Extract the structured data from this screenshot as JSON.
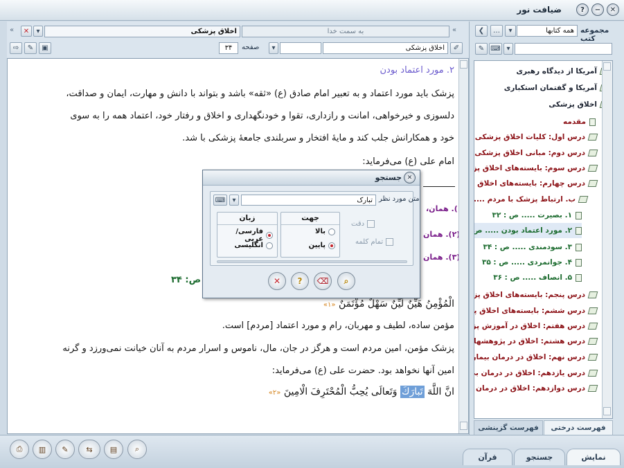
{
  "window": {
    "title": "ضیافت نور",
    "controls": [
      "close-icon",
      "minimize-icon",
      "help-icon"
    ]
  },
  "right_panel": {
    "label": "مجموعه کتب",
    "collection_select": "همه کتابها",
    "search_value": "",
    "tree": [
      {
        "label": "آمریکا از دیدگاه رهبری",
        "kind": "book",
        "color": "dark"
      },
      {
        "label": "آمریکا و گفتمان استکباری",
        "kind": "book",
        "color": "dark"
      },
      {
        "label": "اخلاق پزشکی",
        "kind": "book-open",
        "color": "dark"
      },
      {
        "label": "مقدمه",
        "kind": "page",
        "color": "red"
      },
      {
        "label": "درس اول: کلیات اخلاق پزشکی",
        "kind": "book",
        "color": "red"
      },
      {
        "label": "درس دوم: مبانی اخلاق پزشکی",
        "kind": "book",
        "color": "red"
      },
      {
        "label": "درس سوم: بایسته‌های اخلاق پز",
        "kind": "book",
        "color": "red"
      },
      {
        "label": "درس چهارم: بایسته‌های اخلاق پز",
        "kind": "book-open",
        "color": "red"
      },
      {
        "label": "ب. ارتباط پزشک با مردم ....",
        "kind": "book-open",
        "color": "red"
      },
      {
        "label": "۱. بصیرت ..... ص : ۳۲",
        "kind": "page",
        "color": "green"
      },
      {
        "label": "۲. مورد اعتماد بودن ..... ص",
        "kind": "page",
        "color": "green",
        "selected": true
      },
      {
        "label": "۳. سودمندی ..... ص : ۳۴",
        "kind": "page",
        "color": "green"
      },
      {
        "label": "۴. جوانمردی ..... ص : ۳۵",
        "kind": "page",
        "color": "green"
      },
      {
        "label": "۵. انصاف ..... ص : ۳۶",
        "kind": "page",
        "color": "green"
      },
      {
        "label": "درس پنجم: بایسته‌های اخلاق پز",
        "kind": "book",
        "color": "red"
      },
      {
        "label": "درس ششم: بایسته‌های اخلاق پز",
        "kind": "book",
        "color": "red"
      },
      {
        "label": "درس هفتم: اخلاق در آموزش پز",
        "kind": "book",
        "color": "red"
      },
      {
        "label": "درس هشتم: اخلاق در پژوهشهای",
        "kind": "book",
        "color": "red"
      },
      {
        "label": "درس نهم: اخلاق در درمان بیمار",
        "kind": "book",
        "color": "red"
      },
      {
        "label": "درس یازدهم: اخلاق در درمان بی",
        "kind": "book",
        "color": "red"
      },
      {
        "label": "درس دوازدهم: اخلاق در درمان بی",
        "kind": "book",
        "color": "red"
      }
    ],
    "tabs": {
      "tree": "فهرست درختی",
      "selective": "فهرست گزینشی"
    }
  },
  "main": {
    "book_title": "اخلاق پزشکی",
    "direction_hint": "به سمت خدا",
    "book_field": "اخلاق پزشکی",
    "page_label": "صفحه",
    "page_value": "۳۴",
    "heading": "۲. مورد اعتماد بودن",
    "paragraph": [
      "پزشک باید مورد اعتماد و به تعبیر امام صادق (ع) «ثقه» باشد و بتواند با دانش و مهارت، ایمان و صداقت،",
      "دلسوزی و خیرخواهی، امانت و رازداری، تقوا و خودنگهداری و اخلاق و رفتار خود، اعتماد همه را به سوی",
      "خود و همکارانش جلب کند و مایهٔ افتخار و سربلندی جامعهٔ پزشکی با شد."
    ],
    "imam_line": "امام علی (ع) می‌فرماید:",
    "footnotes": [
      "(۱). همان،",
      "(۲). همان",
      "(۳). همان"
    ],
    "page_marker": "ص: ۳۴",
    "arabic1": "الْمُؤْمِنُ هَيِّنٌ لَيِّنٌ سَهْلٌ مُؤْتَمَنٌ",
    "ref1": "«۱»",
    "line2": "مؤمن ساده، لطیف و مهربان، رام و مورد اعتماد [مردم] است.",
    "line3": "پزشک مؤمن، امین مردم است و هرگز در جان، مال، ناموس و اسرار مردم به آنان خیانت نمی‌ورزد و گرنه",
    "line4": "امین آنها نخواهد بود. حضرت علی (ع) می‌فرماید:",
    "arabic2_a": "انَّ اللَّهَ",
    "arabic2_highlight": "تَبارَكَ",
    "arabic2_b": "وَتَعالَى يُحِبُّ الْمُحْتَرِفَ الْامِينَ",
    "ref2": "«۲»"
  },
  "search_dialog": {
    "title": "جستجو",
    "text_label": "متن مورد نظر",
    "text_value": "تبارک",
    "direction_group": "جهت",
    "dir_up": "بالا",
    "dir_down": "پایین",
    "direction_selected": "پایین",
    "language_group": "زبان",
    "lang_fa": "فارسی/عربی",
    "lang_en": "انگلیسی",
    "language_selected": "فارسی/عربی",
    "exact_label": "دقت",
    "whole_word_label": "تمام کلمه"
  },
  "bottom": {
    "tabs": {
      "display": "نمایش",
      "search": "جستجو",
      "quran": "قرآن"
    },
    "active_tab": "نمایش"
  },
  "colors": {
    "heading": "#6a5acd",
    "tree_red": "#8b0f14",
    "tree_green": "#1b6b2e",
    "footnote": "#7a1e8a",
    "arabic_ref": "#d4821a",
    "highlight": "#6f9fd8"
  }
}
